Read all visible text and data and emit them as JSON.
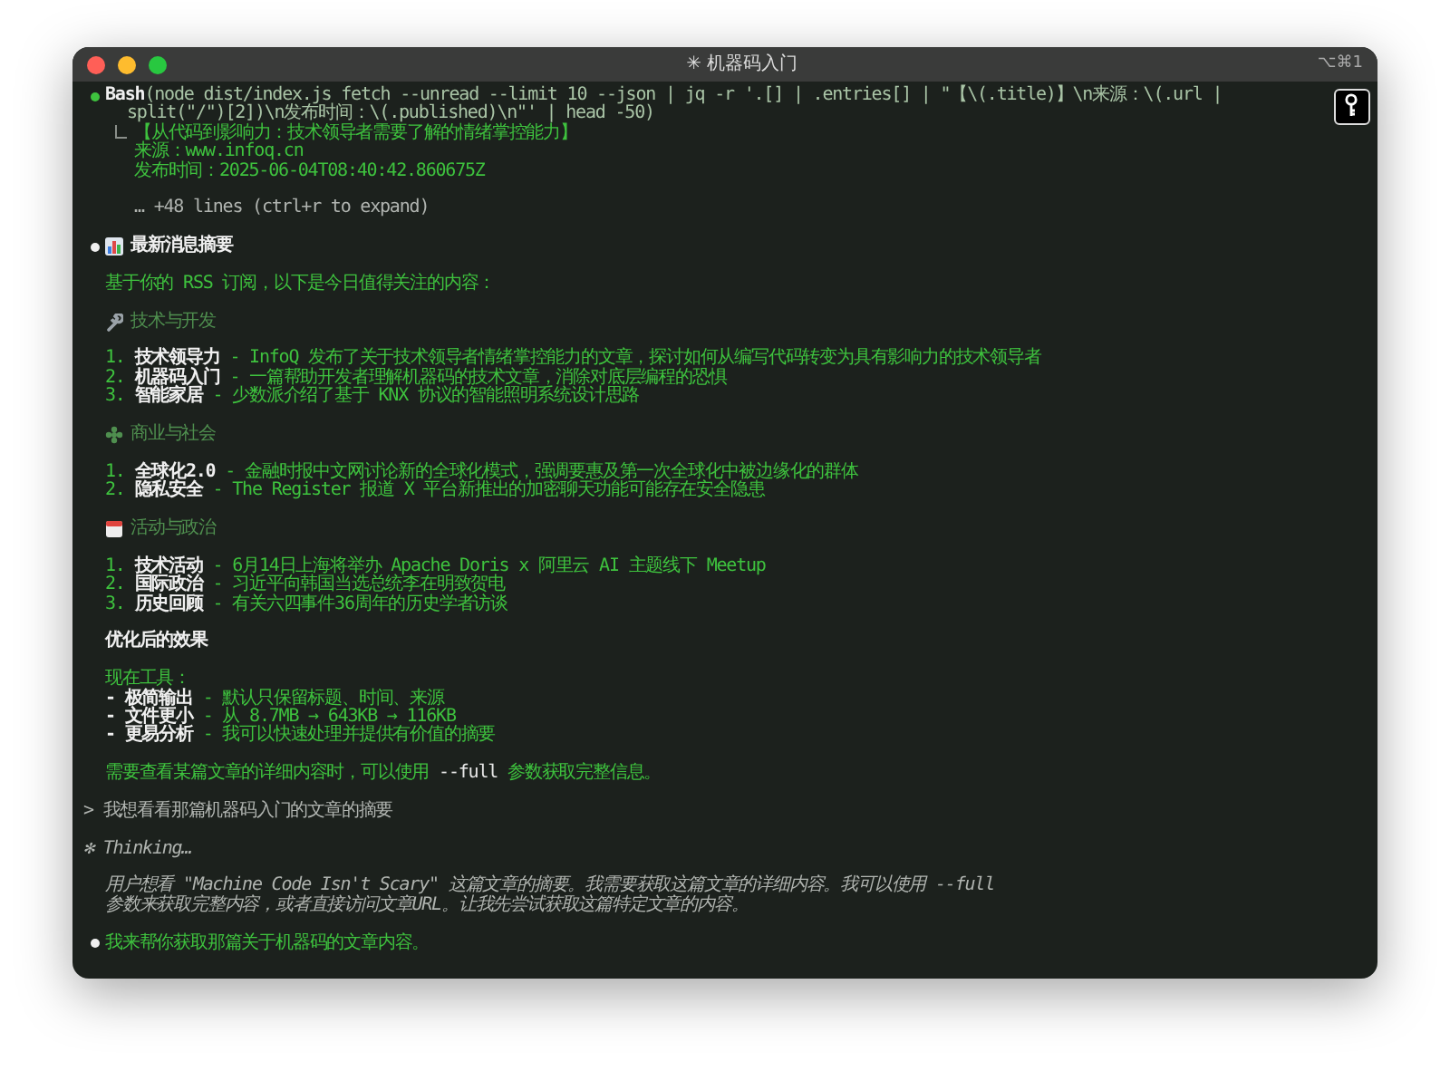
{
  "window": {
    "title": "✳ 机器码入门",
    "shortcut": "⌥⌘1"
  },
  "transcript": [
    {
      "kind": "tool_call",
      "tool": "Bash",
      "command_lines": [
        "(node dist/index.js fetch --unread --limit 10 --json | jq -r '.[] | .entries[] | \"【\\(.title)】\\n来源：\\(.url |",
        "split(\"/\")[2])\\n发布时间：\\(.published)\\n\"' | head -50)"
      ],
      "output_lines": [
        "【从代码到影响力：技术领导者需要了解的情绪掌控能力】",
        "来源：www.infoq.cn",
        "发布时间：2025-06-04T08:40:42.860675Z"
      ],
      "more": "… +48 lines (ctrl+r to expand)"
    },
    {
      "kind": "message",
      "heading": "最新消息摘要",
      "intro": "基于你的 RSS 订阅，以下是今日值得关注的内容：",
      "sections": [
        {
          "title": "技术与开发",
          "items": [
            {
              "num": "1.",
              "term": "技术领导力",
              "desc": "- InfoQ 发布了关于技术领导者情绪掌控能力的文章，探讨如何从编写代码转变为具有影响力的技术领导者"
            },
            {
              "num": "2.",
              "term": "机器码入门",
              "desc": "- 一篇帮助开发者理解机器码的技术文章，消除对底层编程的恐惧"
            },
            {
              "num": "3.",
              "term": "智能家居",
              "desc": "- 少数派介绍了基于 KNX 协议的智能照明系统设计思路"
            }
          ]
        },
        {
          "title": "商业与社会",
          "items": [
            {
              "num": "1.",
              "term": "全球化2.0",
              "desc": "- 金融时报中文网讨论新的全球化模式，强调要惠及第一次全球化中被边缘化的群体"
            },
            {
              "num": "2.",
              "term": "隐私安全",
              "desc": "- The Register 报道 X 平台新推出的加密聊天功能可能存在安全隐患"
            }
          ]
        },
        {
          "title": "活动与政治",
          "items": [
            {
              "num": "1.",
              "term": "技术活动",
              "desc": "- 6月14日上海将举办 Apache Doris x 阿里云 AI 主题线下 Meetup"
            },
            {
              "num": "2.",
              "term": "国际政治",
              "desc": "- 习近平向韩国当选总统李在明致贺电"
            },
            {
              "num": "3.",
              "term": "历史回顾",
              "desc": "- 有关六四事件36周年的历史学者访谈"
            }
          ]
        }
      ],
      "result_title": "优化后的效果",
      "tools_label": "现在工具：",
      "tools": [
        {
          "bullet": "-",
          "term": "极简输出",
          "desc": "- 默认只保留标题、时间、来源"
        },
        {
          "bullet": "-",
          "term": "文件更小",
          "desc": "- 从 8.7MB → 643KB → 116KB"
        },
        {
          "bullet": "-",
          "term": "更易分析",
          "desc": "- 我可以快速处理并提供有价值的摘要"
        }
      ],
      "note": {
        "before": "需要查看某篇文章的详细内容时，可以使用 ",
        "code": "--full",
        "after": " 参数获取完整信息。"
      }
    },
    {
      "kind": "prompt",
      "text": "> 我想看看那篇机器码入门的文章的摘要"
    },
    {
      "kind": "thinking",
      "label": "✻ Thinking…",
      "lines": [
        "用户想看 \"Machine Code Isn't Scary\" 这篇文章的摘要。我需要获取这篇文章的详细内容。我可以使用 --full",
        "参数来获取完整内容，或者直接访问文章URL。让我先尝试获取这篇特定文章的内容。"
      ]
    },
    {
      "kind": "reply",
      "text": "我来帮你获取那篇关于机器码的文章内容。"
    }
  ]
}
